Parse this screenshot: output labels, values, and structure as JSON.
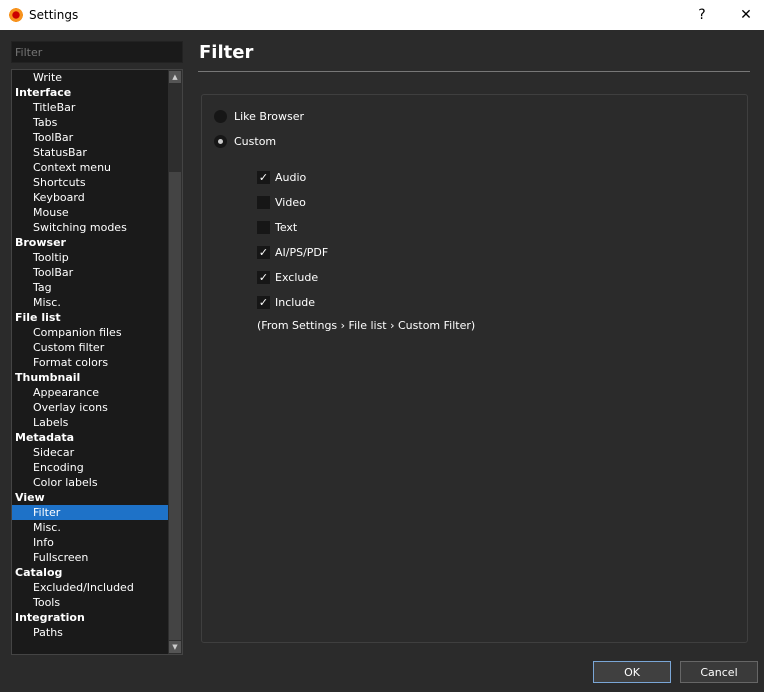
{
  "window": {
    "title": "Settings",
    "help": "?",
    "close": "✕"
  },
  "sidebar": {
    "filter_placeholder": "Filter",
    "items": [
      {
        "label": "Write",
        "cat": false
      },
      {
        "label": "Interface",
        "cat": true
      },
      {
        "label": "TitleBar",
        "cat": false
      },
      {
        "label": "Tabs",
        "cat": false
      },
      {
        "label": "ToolBar",
        "cat": false
      },
      {
        "label": "StatusBar",
        "cat": false
      },
      {
        "label": "Context menu",
        "cat": false
      },
      {
        "label": "Shortcuts",
        "cat": false
      },
      {
        "label": "Keyboard",
        "cat": false
      },
      {
        "label": "Mouse",
        "cat": false
      },
      {
        "label": "Switching modes",
        "cat": false
      },
      {
        "label": "Browser",
        "cat": true
      },
      {
        "label": "Tooltip",
        "cat": false
      },
      {
        "label": "ToolBar",
        "cat": false
      },
      {
        "label": "Tag",
        "cat": false
      },
      {
        "label": "Misc.",
        "cat": false
      },
      {
        "label": "File list",
        "cat": true
      },
      {
        "label": "Companion files",
        "cat": false
      },
      {
        "label": "Custom filter",
        "cat": false
      },
      {
        "label": "Format colors",
        "cat": false
      },
      {
        "label": "Thumbnail",
        "cat": true
      },
      {
        "label": "Appearance",
        "cat": false
      },
      {
        "label": "Overlay icons",
        "cat": false
      },
      {
        "label": "Labels",
        "cat": false
      },
      {
        "label": "Metadata",
        "cat": true
      },
      {
        "label": "Sidecar",
        "cat": false
      },
      {
        "label": "Encoding",
        "cat": false
      },
      {
        "label": "Color labels",
        "cat": false
      },
      {
        "label": "View",
        "cat": true
      },
      {
        "label": "Filter",
        "cat": false,
        "selected": true
      },
      {
        "label": "Misc.",
        "cat": false
      },
      {
        "label": "Info",
        "cat": false
      },
      {
        "label": "Fullscreen",
        "cat": false
      },
      {
        "label": "Catalog",
        "cat": true
      },
      {
        "label": "Excluded/Included",
        "cat": false
      },
      {
        "label": "Tools",
        "cat": false
      },
      {
        "label": "Integration",
        "cat": true
      },
      {
        "label": "Paths",
        "cat": false
      }
    ]
  },
  "main": {
    "title": "Filter",
    "radios": [
      {
        "label": "Like Browser",
        "checked": false
      },
      {
        "label": "Custom",
        "checked": true
      }
    ],
    "checkboxes": [
      {
        "label": "Audio",
        "checked": true
      },
      {
        "label": "Video",
        "checked": false
      },
      {
        "label": "Text",
        "checked": false
      },
      {
        "label": "AI/PS/PDF",
        "checked": true
      },
      {
        "label": "Exclude",
        "checked": true
      },
      {
        "label": "Include",
        "checked": true
      }
    ],
    "note": "(From Settings › File list › Custom Filter)"
  },
  "buttons": {
    "ok": "OK",
    "cancel": "Cancel"
  }
}
